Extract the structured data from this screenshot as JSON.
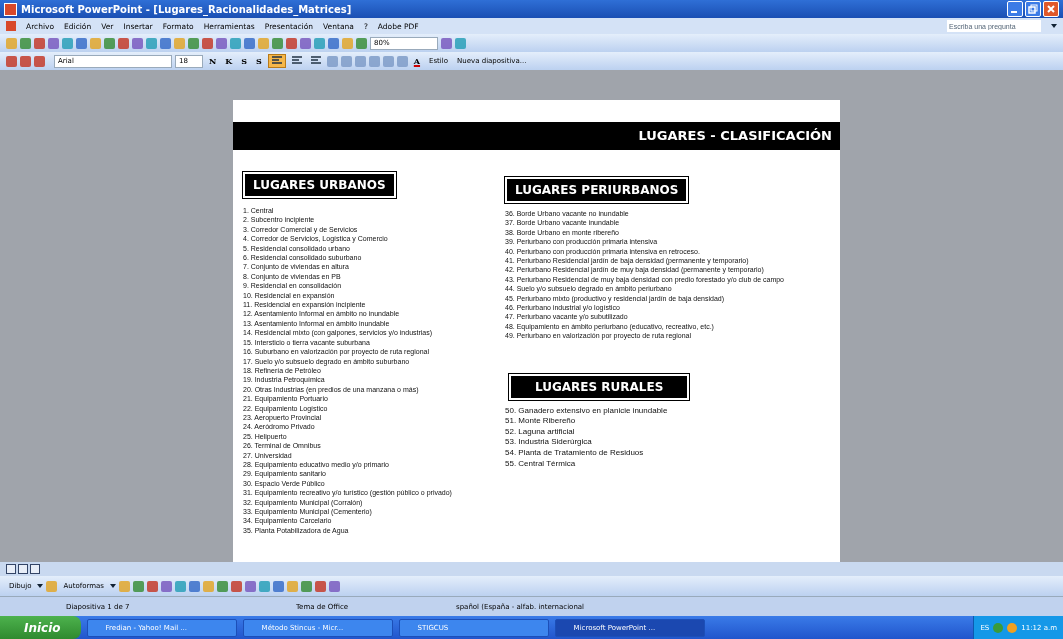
{
  "window": {
    "title": "Microsoft PowerPoint - [Lugares_Racionalidades_Matrices]"
  },
  "menu": [
    "Archivo",
    "Edición",
    "Ver",
    "Insertar",
    "Formato",
    "Herramientas",
    "Presentación",
    "Ventana",
    "?",
    "Adobe PDF"
  ],
  "help_box": {
    "placeholder": "Escriba una pregunta"
  },
  "standard_toolbar": {
    "zoom": "80%"
  },
  "formatting_toolbar": {
    "font": "Arial",
    "size": "18",
    "style_buttons": [
      "N",
      "K",
      "S",
      "S"
    ],
    "alignment": [
      {
        "selected": true
      },
      {
        "selected": false
      },
      {
        "selected": false
      }
    ],
    "font_color": "A",
    "buttons": [
      "Estilo",
      "Nueva diapositiva..."
    ]
  },
  "slide": {
    "header": "LUGARES  - CLASIFICACIÓN",
    "sections": [
      {
        "title": "LUGARES  URBANOS",
        "items": [
          "1.   Central",
          "2.   Subcentro incipiente",
          "3.   Corredor Comercial y de Servicios",
          "4.   Corredor de Servicios, Logística y Comercio",
          "5.   Residencial consolidado urbano",
          "6.   Residencial consolidado suburbano",
          "7.   Conjunto de viviendas en altura",
          "8.   Conjunto de viviendas en PB",
          "9.   Residencial en consolidación",
          "10. Residencial en expansión",
          "11. Residencial en expansión incipiente",
          "12. Asentamiento Informal en ámbito no inundable",
          "13. Asentamiento Informal en ámbito inundable",
          "14. Residencial mixto (con galpones, servicios y/o industrias)",
          "15. Intersticio o tierra vacante suburbana",
          "16. Suburbano en valorización por proyecto de ruta regional",
          "17. Suelo y/o subsuelo degrado en ámbito suburbano",
          "18. Refinería de Petróleo",
          "19. Industria Petroquímica",
          "20. Otras Industrias (en predios de una manzana o más)",
          "21. Equipamiento Portuario",
          "22. Equipamiento Logístico",
          "23. Aeropuerto Provincial",
          "24. Aeródromo Privado",
          "25. Helipuerto",
          "26. Terminal de Omnibus",
          "27. Universidad",
          "28. Equipamiento educativo medio y/o primario",
          "29. Equipamiento sanitario",
          "30. Espacio Verde Público",
          "31. Equipamiento recreativo y/o turístico (gestión público o privado)",
          "32. Equipamiento Municipal (Corralón)",
          "33. Equipamiento Municipal (Cementerio)",
          "34. Equipamiento Carcelario",
          "35. Planta Potabilizadora de Agua"
        ]
      },
      {
        "title": "LUGARES  PERIURBANOS",
        "items": [
          "36. Borde Urbano vacante no inundable",
          "37. Borde Urbano vacante inundable",
          "38. Borde Urbano en monte ribereño",
          "39. Periurbano con producción primaria intensiva",
          "40. Periurbano con producción primaria intensiva en retroceso.",
          "41. Periurbano Residencial jardín de baja densidad (permanente y temporario)",
          "42. Periurbano Residencial jardín de muy baja densidad (permanente y temporario)",
          "43. Periurbano Residencial de muy baja densidad con predio forestado y/o club de campo",
          "44. Suelo y/o subsuelo degrado en ámbito periurbano",
          "45. Periurbano mixto (productivo y residencial jardín de baja densidad)",
          "46. Periurbano industrial y/o logístico",
          "47. Periurbano vacante y/o subutilizado",
          "48. Equipamiento en ámbito periurbano (educativo, recreativo, etc.)",
          "49. Periurbano en valorización por proyecto de ruta regional"
        ]
      },
      {
        "title": "LUGARES  RURALES",
        "items": [
          "50. Ganadero extensivo en planicie inundable",
          "51. Monte Ribereño",
          "52. Laguna artificial",
          "53. Industria Siderúrgica",
          "54. Planta de Tratamiento de Residuos",
          "55. Central Térmica"
        ]
      }
    ]
  },
  "drawing_toolbar": {
    "buttons": [
      "Dibujo",
      "Autoformas"
    ]
  },
  "status_bar": [
    "Diapositiva 1 de 7",
    "Tema de Office",
    "spañol (España - alfab. internacional"
  ],
  "taskbar": {
    "start": "Inicio",
    "tasks": [
      {
        "label": "Fredian - Yahoo! Mail ...",
        "selected": false
      },
      {
        "label": "Método Stincus - Micr...",
        "selected": false
      },
      {
        "label": "STIGCUS",
        "selected": false
      },
      {
        "label": "Microsoft PowerPoint ...",
        "selected": true
      }
    ],
    "language": "ES",
    "clock": "11:12 a.m"
  }
}
